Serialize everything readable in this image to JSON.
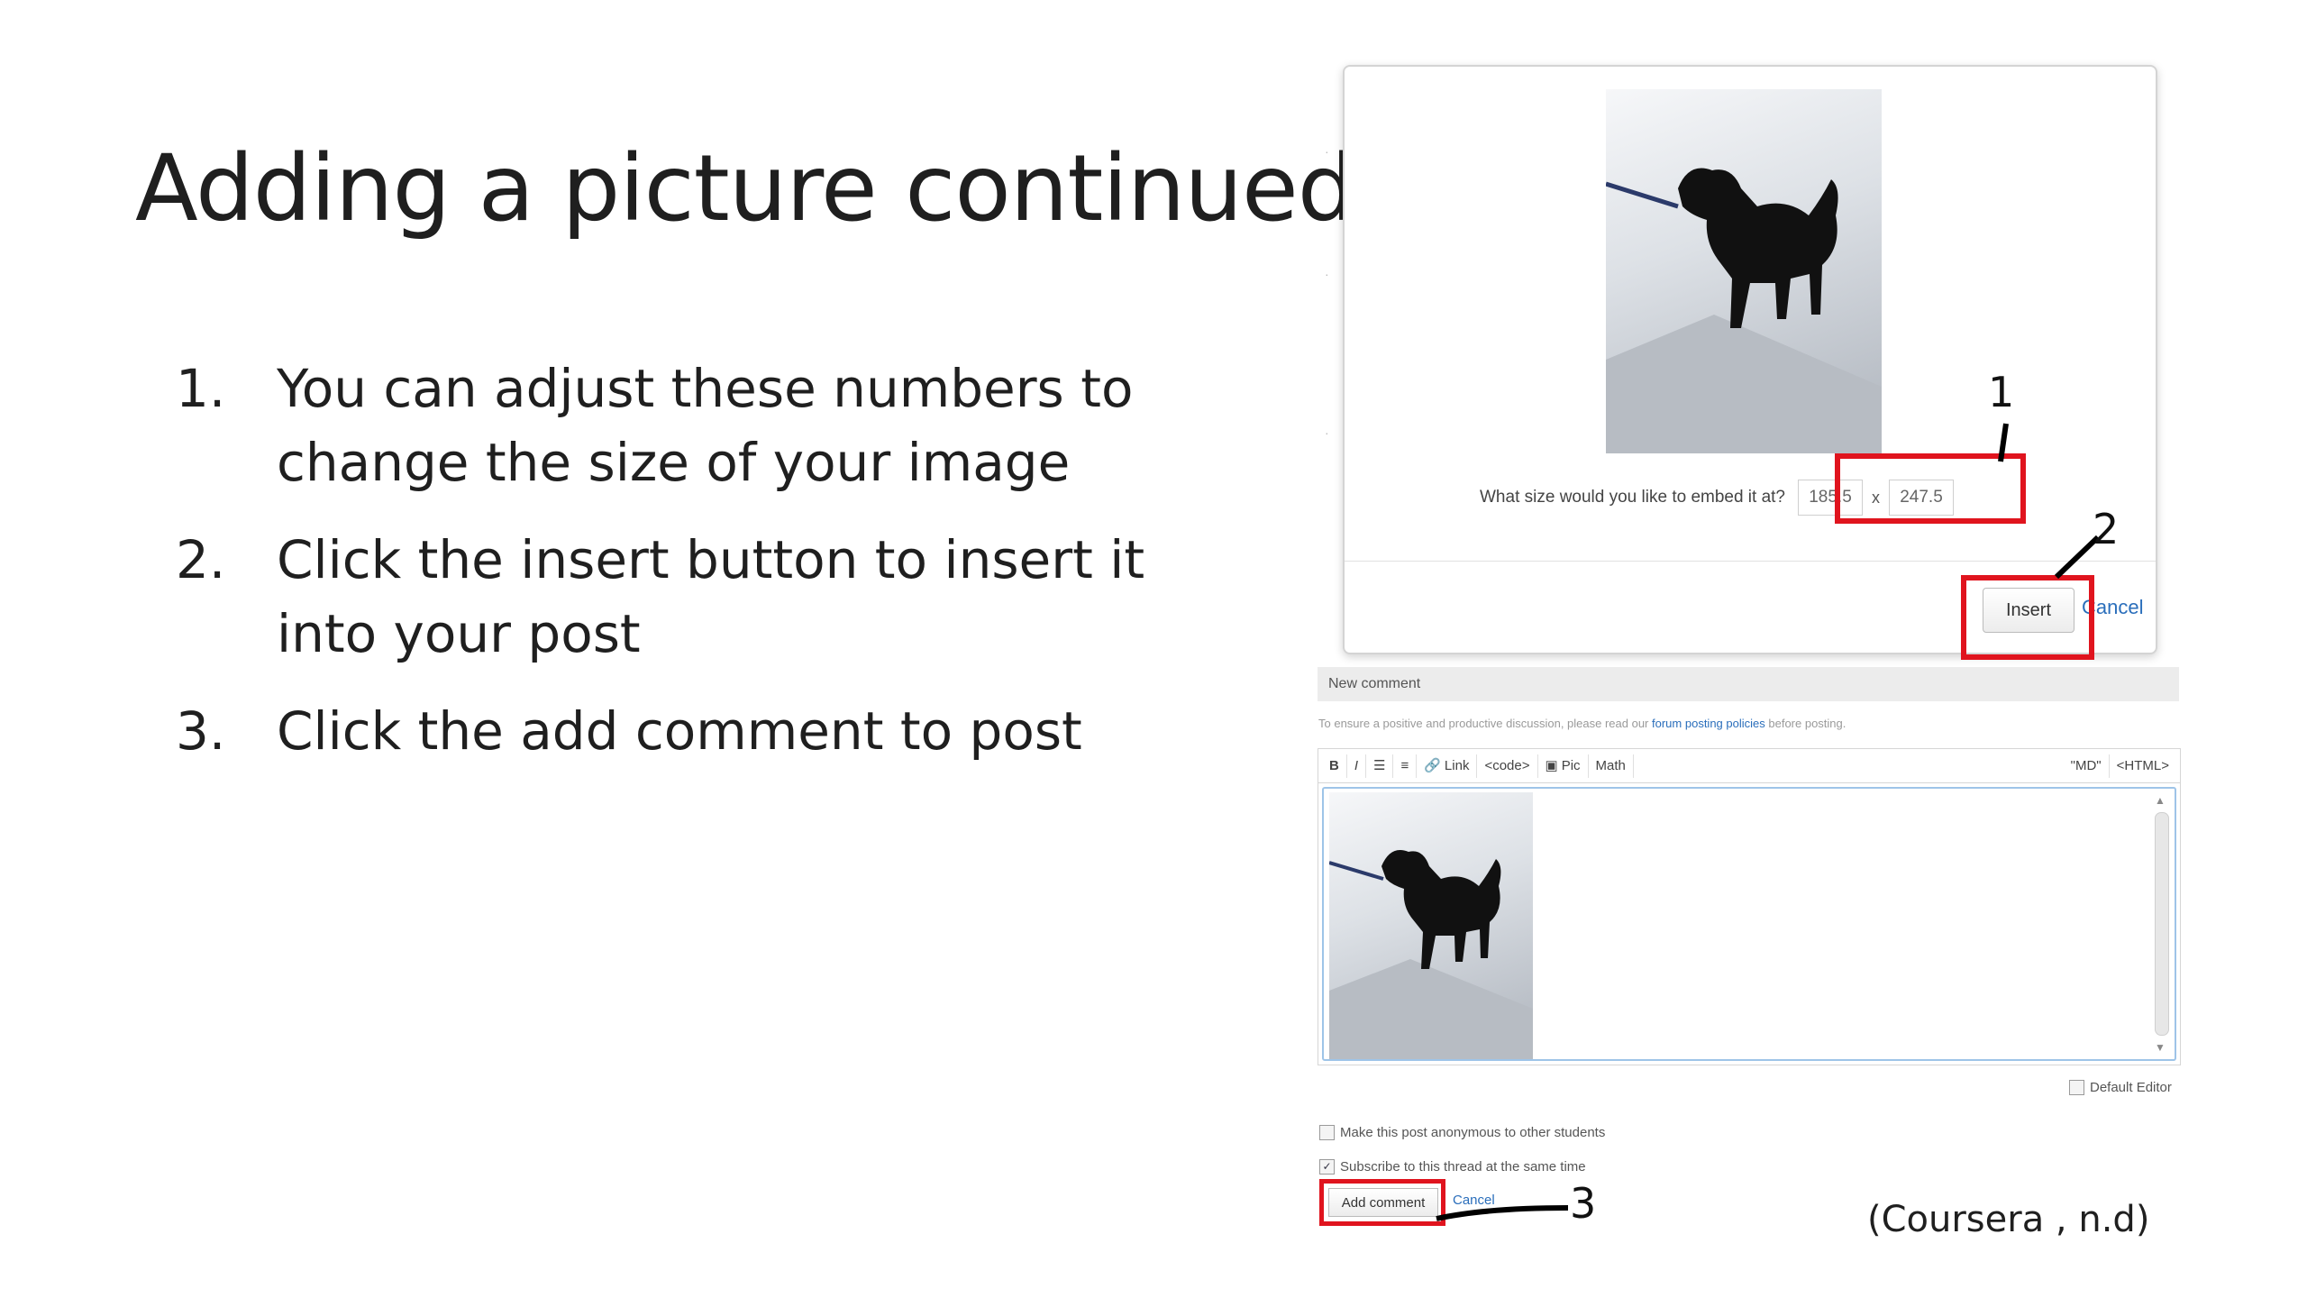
{
  "slide": {
    "title": "Adding a picture continued",
    "steps": [
      {
        "num": "1.",
        "text": "You can adjust these numbers to change the size of your image"
      },
      {
        "num": "2.",
        "text": "Click the insert button to insert it into your post"
      },
      {
        "num": "3.",
        "text": "Click the add comment to post"
      }
    ],
    "citation": "(Coursera , n.d)"
  },
  "dialog": {
    "size_prompt": "What size would you like to embed it at?",
    "width_value": "185.5",
    "height_value": "247.5",
    "separator": "x",
    "insert_label": "Insert",
    "cancel_label": "Cancel"
  },
  "editor": {
    "header": "New comment",
    "policy_before": "To ensure a positive and productive discussion, please read our",
    "policy_link": "forum posting policies",
    "policy_after": "before posting.",
    "toolbar": {
      "bold": "B",
      "italic": "I",
      "link": "Link",
      "code": "<code>",
      "pic": "Pic",
      "math": "Math",
      "md": "\"MD\"",
      "html": "<HTML>"
    },
    "default_editor": "Default Editor",
    "anonymous_label": "Make this post anonymous to other students",
    "subscribe_label": "Subscribe to this thread at the same time",
    "add_comment_label": "Add comment",
    "cancel_label": "Cancel"
  },
  "callouts": [
    "1",
    "2",
    "3"
  ],
  "colors": {
    "highlight": "#e0141e",
    "link": "#2a6ebb",
    "editor_focus": "#9ec4e8"
  }
}
